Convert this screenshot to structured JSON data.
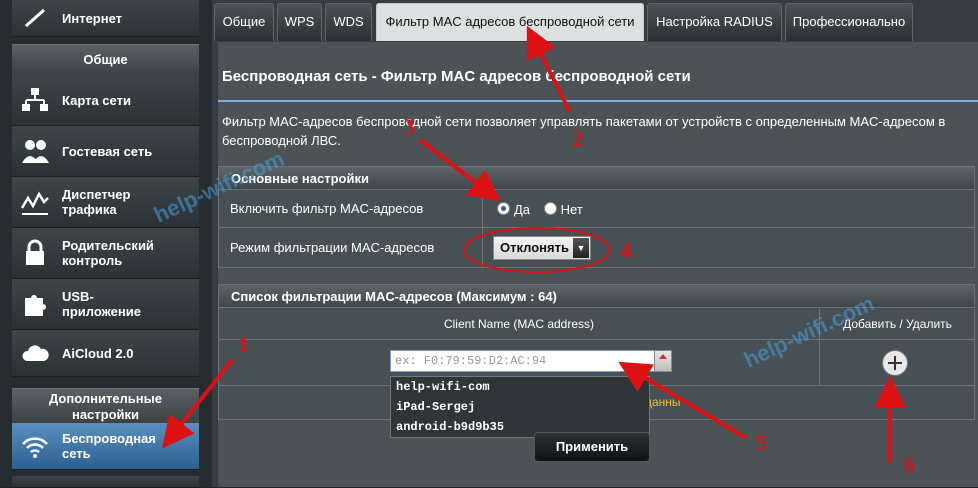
{
  "sidebar": {
    "top_item": "Интернет",
    "general_header": "Общие",
    "items": [
      {
        "label": "Карта сети",
        "icon": "network-map-icon"
      },
      {
        "label": "Гостевая сеть",
        "icon": "guest-network-icon"
      },
      {
        "label": "Диспетчер трафика",
        "icon": "traffic-manager-icon"
      },
      {
        "label": "Родительский контроль",
        "icon": "lock-icon"
      },
      {
        "label": "USB-приложение",
        "icon": "puzzle-icon"
      },
      {
        "label": "AiCloud 2.0",
        "icon": "cloud-icon"
      }
    ],
    "advanced_header": "Дополнительные настройки",
    "active_item": {
      "label": "Беспроводная сеть",
      "icon": "wifi-icon"
    }
  },
  "tabs": [
    {
      "label": "Общие"
    },
    {
      "label": "WPS"
    },
    {
      "label": "WDS"
    },
    {
      "label": "Фильтр MAC адресов беспроводной сети",
      "active": true
    },
    {
      "label": "Настройка RADIUS"
    },
    {
      "label": "Профессионально"
    }
  ],
  "page": {
    "title": "Беспроводная сеть - Фильтр MAC адресов беспроводной сети",
    "description": "Фильтр MAC-адресов беспроводной сети позволяет управлять пакетами от устройств с определенным MAC-адресом в беспроводной ЛВС."
  },
  "basic": {
    "header": "Основные настройки",
    "enable_label": "Включить фильтр MAC-адресов",
    "yes_label": "Да",
    "no_label": "Нет",
    "mode_label": "Режим фильтрации MAC-адресов",
    "mode_value": "Отклонять"
  },
  "list": {
    "header": "Список фильтрации MAC-адресов (Максимум : 64)",
    "col_client": "Client Name (MAC address)",
    "col_action": "Добавить / Удалить",
    "input_placeholder": "ex: F0:79:59:D2:AC:94",
    "dropdown_items": [
      "help-wifi-com",
      "iPad-Sergej",
      "android-b9d9b35"
    ],
    "partial_text": "данны"
  },
  "apply_label": "Применить",
  "watermark": "help-wifi.com",
  "annotations": [
    "1",
    "2",
    "3",
    "4",
    "5",
    "6"
  ],
  "colors": {
    "accent": "#7bb0d8",
    "annotation": "#d11111"
  }
}
